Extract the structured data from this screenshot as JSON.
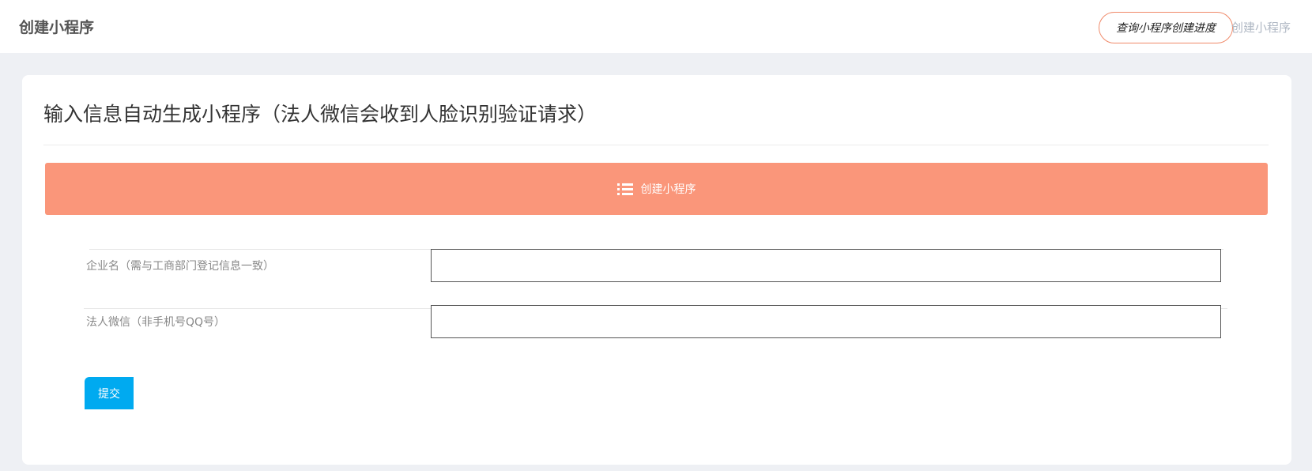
{
  "header": {
    "title": "创建小程序",
    "progress_link": "查询小程序创建进度",
    "create_link": "创建小程序"
  },
  "card": {
    "title": "输入信息自动生成小程序（法人微信会收到人脸识别验证请求）",
    "banner_icon": "list-icon",
    "banner_label": "创建小程序"
  },
  "form": {
    "company_label": "企业名（需与工商部门登记信息一致）",
    "company_value": "",
    "wechat_label": "法人微信（非手机号QQ号）",
    "wechat_value": "",
    "submit_label": "提交"
  },
  "colors": {
    "banner": "#fa967a",
    "submit": "#00aaf0",
    "progress_border": "#f08a6a"
  }
}
